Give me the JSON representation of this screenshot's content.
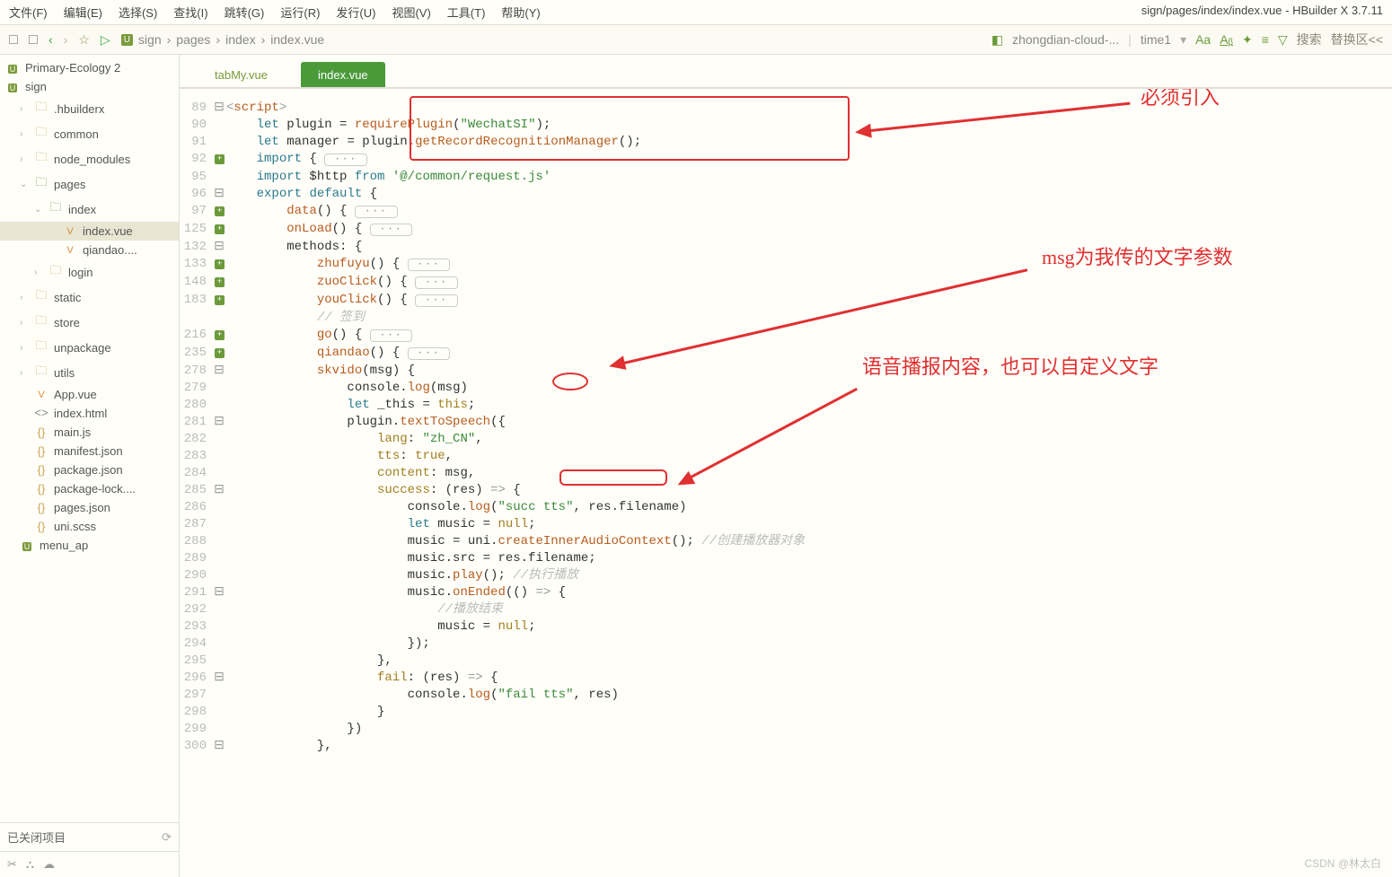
{
  "title": "sign/pages/index/index.vue - HBuilder X 3.7.11",
  "menu": [
    "文件(F)",
    "编辑(E)",
    "选择(S)",
    "查找(I)",
    "跳转(G)",
    "运行(R)",
    "发行(U)",
    "视图(V)",
    "工具(T)",
    "帮助(Y)"
  ],
  "breadcrumb": [
    "sign",
    "pages",
    "index",
    "index.vue"
  ],
  "run_config": "zhongdian-cloud-...",
  "time_label": "time1",
  "search_label": "搜索",
  "replace_label": "替换区<<",
  "projects": [
    {
      "name": "Primary-Ecology 2",
      "type": "proj"
    },
    {
      "name": "sign",
      "type": "proj",
      "open": true
    }
  ],
  "tree": [
    {
      "chev": ">",
      "icon": "folder",
      "label": ".hbuilderx",
      "pad": 1
    },
    {
      "chev": ">",
      "icon": "folder",
      "label": "common",
      "pad": 1
    },
    {
      "chev": ">",
      "icon": "folder",
      "label": "node_modules",
      "pad": 1
    },
    {
      "chev": "v",
      "icon": "folder-green",
      "label": "pages",
      "pad": 1
    },
    {
      "chev": "v",
      "icon": "folder-green",
      "label": "index",
      "pad": 2
    },
    {
      "chev": "",
      "icon": "vue",
      "label": "index.vue",
      "pad": 3,
      "sel": true
    },
    {
      "chev": "",
      "icon": "vue",
      "label": "qiandao....",
      "pad": 3
    },
    {
      "chev": ">",
      "icon": "folder",
      "label": "login",
      "pad": 2
    },
    {
      "chev": ">",
      "icon": "folder",
      "label": "static",
      "pad": 1
    },
    {
      "chev": ">",
      "icon": "folder",
      "label": "store",
      "pad": 1
    },
    {
      "chev": ">",
      "icon": "folder",
      "label": "unpackage",
      "pad": 1
    },
    {
      "chev": ">",
      "icon": "folder",
      "label": "utils",
      "pad": 1
    },
    {
      "chev": "",
      "icon": "vue",
      "label": "App.vue",
      "pad": 1
    },
    {
      "chev": "",
      "icon": "code",
      "label": "index.html",
      "pad": 1
    },
    {
      "chev": "",
      "icon": "js",
      "label": "main.js",
      "pad": 1
    },
    {
      "chev": "",
      "icon": "js",
      "label": "manifest.json",
      "pad": 1
    },
    {
      "chev": "",
      "icon": "js",
      "label": "package.json",
      "pad": 1
    },
    {
      "chev": "",
      "icon": "js",
      "label": "package-lock....",
      "pad": 1
    },
    {
      "chev": "",
      "icon": "js",
      "label": "pages.json",
      "pad": 1
    },
    {
      "chev": "",
      "icon": "js",
      "label": "uni.scss",
      "pad": 1
    },
    {
      "chev": "",
      "icon": "proj",
      "label": "menu_ap",
      "pad": 0
    }
  ],
  "closed_projects": "已关闭项目",
  "tabs": [
    {
      "label": "tabMy.vue",
      "active": false
    },
    {
      "label": "index.vue",
      "active": true
    }
  ],
  "code": [
    {
      "n": 89,
      "fold": "⊟",
      "html": "<span class='op'>&lt;</span><span class='fn'>script</span><span class='op'>&gt;</span>"
    },
    {
      "n": 90,
      "fold": "",
      "html": "    <span class='kw'>let</span> plugin = <span class='fn'>requirePlugin</span>(<span class='str'>\"WechatSI\"</span>);"
    },
    {
      "n": 91,
      "fold": "",
      "html": "    <span class='kw'>let</span> manager = plugin.<span class='fn'>getRecordRecognitionManager</span>();"
    },
    {
      "n": 92,
      "fold": "+",
      "html": "    <span class='kw'>import</span> { <span class='collapse'>···</span>"
    },
    {
      "n": 95,
      "fold": "",
      "html": "    <span class='kw'>import</span> $http <span class='kw'>from</span> <span class='str'>'@/common/request.js'</span>"
    },
    {
      "n": 96,
      "fold": "⊟",
      "html": "    <span class='kw'>export</span> <span class='kw'>default</span> {"
    },
    {
      "n": 97,
      "fold": "+",
      "html": "        <span class='fn'>data</span>() { <span class='collapse'>···</span>"
    },
    {
      "n": 125,
      "fold": "+",
      "html": "        <span class='fn'>onLoad</span>() { <span class='collapse'>···</span>"
    },
    {
      "n": 132,
      "fold": "⊟",
      "html": "        methods: {"
    },
    {
      "n": 133,
      "fold": "+",
      "html": "            <span class='fn'>zhufuyu</span>() { <span class='collapse'>···</span>"
    },
    {
      "n": 148,
      "fold": "+",
      "html": "            <span class='fn'>zuoClick</span>() { <span class='collapse'>···</span>"
    },
    {
      "n": 183,
      "fold": "+",
      "html": "            <span class='fn'>youClick</span>() { <span class='collapse'>···</span>"
    },
    {
      "n": "",
      "fold": "",
      "html": "            <span class='comment'>// 签到</span>"
    },
    {
      "n": 216,
      "fold": "+",
      "html": "            <span class='fn'>go</span>() { <span class='collapse'>···</span>"
    },
    {
      "n": 235,
      "fold": "+",
      "html": "            <span class='fn'>qiandao</span>() { <span class='collapse'>···</span>"
    },
    {
      "n": 278,
      "fold": "⊟",
      "html": "            <span class='fn'>skvido</span>(msg) {"
    },
    {
      "n": 279,
      "fold": "",
      "html": "                console.<span class='fn'>log</span>(msg)"
    },
    {
      "n": 280,
      "fold": "",
      "html": "                <span class='kw'>let</span> _this = <span class='kw2'>this</span>;"
    },
    {
      "n": 281,
      "fold": "⊟",
      "html": "                plugin.<span class='fn'>textToSpeech</span>({"
    },
    {
      "n": 282,
      "fold": "",
      "html": "                    <span class='prop'>lang</span>: <span class='str'>\"zh_CN\"</span>,"
    },
    {
      "n": 283,
      "fold": "",
      "html": "                    <span class='prop'>tts</span>: <span class='kw2'>true</span>,"
    },
    {
      "n": 284,
      "fold": "",
      "html": "                    <span class='prop'>content</span>: msg,"
    },
    {
      "n": 285,
      "fold": "⊟",
      "html": "                    <span class='prop'>success</span>: (res) <span class='op'>=&gt;</span> {"
    },
    {
      "n": 286,
      "fold": "",
      "html": "                        console.<span class='fn'>log</span>(<span class='str'>\"succ tts\"</span>, res.filename)"
    },
    {
      "n": 287,
      "fold": "",
      "html": "                        <span class='kw'>let</span> music = <span class='kw2'>null</span>;"
    },
    {
      "n": 288,
      "fold": "",
      "html": "                        music = uni.<span class='fn'>createInnerAudioContext</span>(); <span class='comment'>//创建播放器对象</span>"
    },
    {
      "n": 289,
      "fold": "",
      "html": "                        music.src = res.filename;"
    },
    {
      "n": 290,
      "fold": "",
      "html": "                        music.<span class='fn'>play</span>(); <span class='comment'>//执行播放</span>"
    },
    {
      "n": 291,
      "fold": "⊟",
      "html": "                        music.<span class='fn'>onEnded</span>(() <span class='op'>=&gt;</span> {"
    },
    {
      "n": 292,
      "fold": "",
      "html": "                            <span class='comment'>//播放结束</span>"
    },
    {
      "n": 293,
      "fold": "",
      "html": "                            music = <span class='kw2'>null</span>;"
    },
    {
      "n": 294,
      "fold": "",
      "html": "                        });"
    },
    {
      "n": 295,
      "fold": "",
      "html": "                    },"
    },
    {
      "n": 296,
      "fold": "⊟",
      "html": "                    <span class='prop'>fail</span>: (res) <span class='op'>=&gt;</span> {"
    },
    {
      "n": 297,
      "fold": "",
      "html": "                        console.<span class='fn'>log</span>(<span class='str'>\"fail tts\"</span>, res)"
    },
    {
      "n": 298,
      "fold": "",
      "html": "                    }"
    },
    {
      "n": 299,
      "fold": "",
      "html": "                })"
    },
    {
      "n": 300,
      "fold": "⊟",
      "html": "            },"
    }
  ],
  "annotations": {
    "a1": "必须引入",
    "a2": "msg为我传的文字参数",
    "a3": "语音播报内容，也可以自定义文字"
  },
  "watermark": "CSDN @林太白"
}
